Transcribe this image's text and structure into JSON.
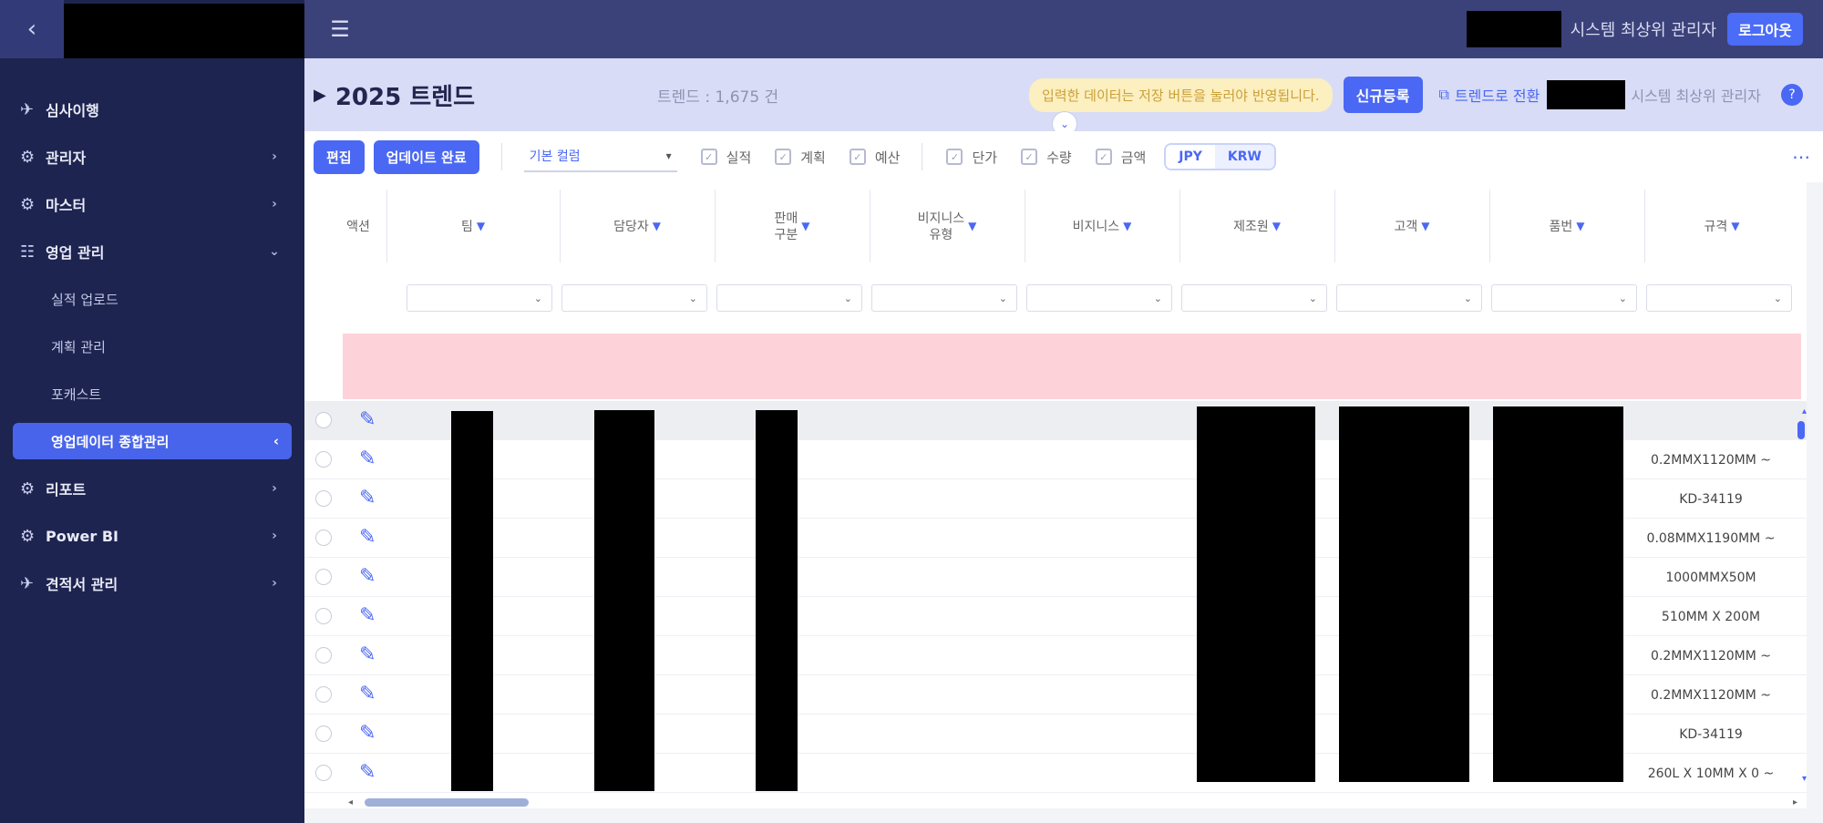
{
  "sidebar": {
    "collapse_icon": "‹",
    "items": [
      {
        "label": "심사이행",
        "icon": "✈",
        "arrow": ""
      },
      {
        "label": "관리자",
        "icon": "⚙",
        "arrow": "›"
      },
      {
        "label": "마스터",
        "icon": "⚙",
        "arrow": "›"
      },
      {
        "label": "영업 관리",
        "icon": "☷",
        "arrow": "⌄"
      }
    ],
    "sub_items": [
      {
        "label": "실적 업로드"
      },
      {
        "label": "계획 관리"
      },
      {
        "label": "포캐스트"
      },
      {
        "label": "영업데이터 종합관리",
        "arrow": "‹"
      }
    ],
    "items_after": [
      {
        "label": "리포트",
        "icon": "⚙",
        "arrow": "›"
      },
      {
        "label": "Power BI",
        "icon": "⚙",
        "arrow": "›"
      },
      {
        "label": "견적서 관리",
        "icon": "✈",
        "arrow": "›"
      }
    ]
  },
  "topbar": {
    "menu_icon": "☰",
    "user_role": "시스템 최상위 관리자",
    "logout_label": "로그아웃"
  },
  "titlebar": {
    "play_icon": "▶",
    "title": "2025 트렌드",
    "subtitle": "트렌드 : 1,675 건",
    "notice": "입력한 데이터는 저장 버튼을 눌러야 반영됩니다.",
    "button": "신규등록",
    "link_icon": "⧉",
    "link_label": "트렌드로 전환",
    "user_role": "시스템 최상위 관리자",
    "help_icon": "?",
    "drop_icon": "⌄"
  },
  "toolbar": {
    "edit_label": "편집",
    "upload_label": "업데이트 완료",
    "select_value": "기본 컬럼",
    "checks": [
      "실적",
      "계획",
      "예산",
      "단가",
      "수량",
      "금액"
    ],
    "currency_on": "JPY",
    "currency_off": "KRW",
    "more_icon": "⋯"
  },
  "grid": {
    "columns": [
      {
        "label": "액션",
        "filter": false
      },
      {
        "label": "팀",
        "filter": true
      },
      {
        "label": "담당자",
        "filter": true
      },
      {
        "label": "판매\n구분",
        "filter": true
      },
      {
        "label": "비지니스\n유형",
        "filter": true
      },
      {
        "label": "비지니스",
        "filter": true
      },
      {
        "label": "제조원",
        "filter": true
      },
      {
        "label": "고객",
        "filter": true
      },
      {
        "label": "품번",
        "filter": true
      },
      {
        "label": "규격",
        "filter": true
      }
    ],
    "filter_icon": "⌄",
    "edit_icon": "✎",
    "rows": [
      {
        "spec": ""
      },
      {
        "spec": "0.2MMX1120MM ~"
      },
      {
        "spec": "KD-34119"
      },
      {
        "spec": "0.08MMX1190MM ~"
      },
      {
        "spec": "1000MMX50M"
      },
      {
        "spec": "510MM X 200M"
      },
      {
        "spec": "0.2MMX1120MM ~"
      },
      {
        "spec": "0.2MMX1120MM ~"
      },
      {
        "spec": "KD-34119"
      },
      {
        "spec": "260L X 10MM X 0 ~"
      }
    ]
  },
  "scroll": {
    "left": "◂",
    "right": "▸",
    "up": "▴",
    "down": "▾"
  }
}
